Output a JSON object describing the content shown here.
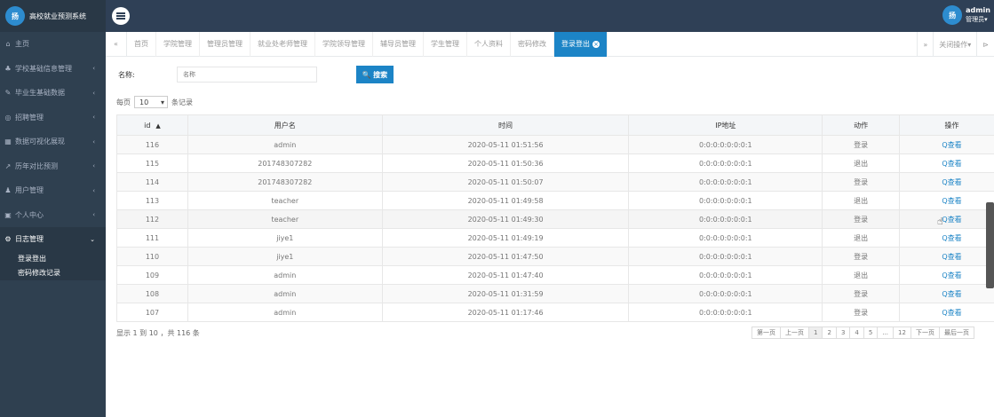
{
  "app": {
    "logo_text": "扬",
    "title": "高校就业预测系统"
  },
  "user": {
    "avatar_text": "扬",
    "name": "admin",
    "role": "管理员▾"
  },
  "sidebar": {
    "items": [
      {
        "icon": "home-icon",
        "glyph": "⌂",
        "label": "主页",
        "chevron": ""
      },
      {
        "icon": "users-icon",
        "glyph": "♣",
        "label": "学校基础信息管理",
        "chevron": "‹"
      },
      {
        "icon": "graduate-icon",
        "glyph": "✎",
        "label": "毕业生基础数据",
        "chevron": "‹"
      },
      {
        "icon": "recruit-icon",
        "glyph": "◎",
        "label": "招聘管理",
        "chevron": "‹"
      },
      {
        "icon": "chart-icon",
        "glyph": "▦",
        "label": "数据可视化展现",
        "chevron": "‹"
      },
      {
        "icon": "trend-icon",
        "glyph": "↗",
        "label": "历年对比预测",
        "chevron": "‹"
      },
      {
        "icon": "user-icon",
        "glyph": "♟",
        "label": "用户管理",
        "chevron": "‹"
      },
      {
        "icon": "profile-icon",
        "glyph": "▣",
        "label": "个人中心",
        "chevron": "‹"
      },
      {
        "icon": "log-icon",
        "glyph": "⚙",
        "label": "日志管理",
        "chevron": "⌄"
      }
    ],
    "subitems": [
      {
        "label": "登录登出"
      },
      {
        "label": "密码修改记录"
      }
    ]
  },
  "tabs": {
    "left_nav": "«",
    "items": [
      {
        "label": "首页"
      },
      {
        "label": "学院管理"
      },
      {
        "label": "管理员管理"
      },
      {
        "label": "就业处老师管理"
      },
      {
        "label": "学院领导管理"
      },
      {
        "label": "辅导员管理"
      },
      {
        "label": "学生管理"
      },
      {
        "label": "个人资料"
      },
      {
        "label": "密码修改"
      }
    ],
    "active": {
      "label": "登录登出",
      "close": "×"
    },
    "right_nav": "»",
    "close_ops": "关闭操作▾",
    "exit": "⊳"
  },
  "search": {
    "label": "名称:",
    "placeholder": "名称",
    "button": "🔍 搜索"
  },
  "page_size": {
    "prefix": "每页",
    "value": "10",
    "suffix": "条记录"
  },
  "table": {
    "headers": [
      "id",
      "用户名",
      "时间",
      "IP地址",
      "动作",
      "操作"
    ],
    "sort_indicator": "▲",
    "rows": [
      {
        "id": "116",
        "user": "admin",
        "time": "2020-05-11 01:51:56",
        "ip": "0:0:0:0:0:0:0:1",
        "action": "登录",
        "op": "Q查看"
      },
      {
        "id": "115",
        "user": "201748307282",
        "time": "2020-05-11 01:50:36",
        "ip": "0:0:0:0:0:0:0:1",
        "action": "退出",
        "op": "Q查看"
      },
      {
        "id": "114",
        "user": "201748307282",
        "time": "2020-05-11 01:50:07",
        "ip": "0:0:0:0:0:0:0:1",
        "action": "登录",
        "op": "Q查看"
      },
      {
        "id": "113",
        "user": "teacher",
        "time": "2020-05-11 01:49:58",
        "ip": "0:0:0:0:0:0:0:1",
        "action": "退出",
        "op": "Q查看"
      },
      {
        "id": "112",
        "user": "teacher",
        "time": "2020-05-11 01:49:30",
        "ip": "0:0:0:0:0:0:0:1",
        "action": "登录",
        "op": "Q查看"
      },
      {
        "id": "111",
        "user": "jiye1",
        "time": "2020-05-11 01:49:19",
        "ip": "0:0:0:0:0:0:0:1",
        "action": "退出",
        "op": "Q查看"
      },
      {
        "id": "110",
        "user": "jiye1",
        "time": "2020-05-11 01:47:50",
        "ip": "0:0:0:0:0:0:0:1",
        "action": "登录",
        "op": "Q查看"
      },
      {
        "id": "109",
        "user": "admin",
        "time": "2020-05-11 01:47:40",
        "ip": "0:0:0:0:0:0:0:1",
        "action": "退出",
        "op": "Q查看"
      },
      {
        "id": "108",
        "user": "admin",
        "time": "2020-05-11 01:31:59",
        "ip": "0:0:0:0:0:0:0:1",
        "action": "登录",
        "op": "Q查看"
      },
      {
        "id": "107",
        "user": "admin",
        "time": "2020-05-11 01:17:46",
        "ip": "0:0:0:0:0:0:0:1",
        "action": "登录",
        "op": "Q查看"
      }
    ]
  },
  "footer": {
    "info": "显示 1 到 10 ，共 116 条"
  },
  "pagination": {
    "first": "第一页",
    "prev": "上一页",
    "pages": [
      "1",
      "2",
      "3",
      "4",
      "5",
      "...",
      "12"
    ],
    "current": "1",
    "next": "下一页",
    "last": "最后一页"
  },
  "colors": {
    "header_bg": "#2f4056",
    "sidebar_bg": "#2f4050",
    "accent": "#1c84c6"
  }
}
